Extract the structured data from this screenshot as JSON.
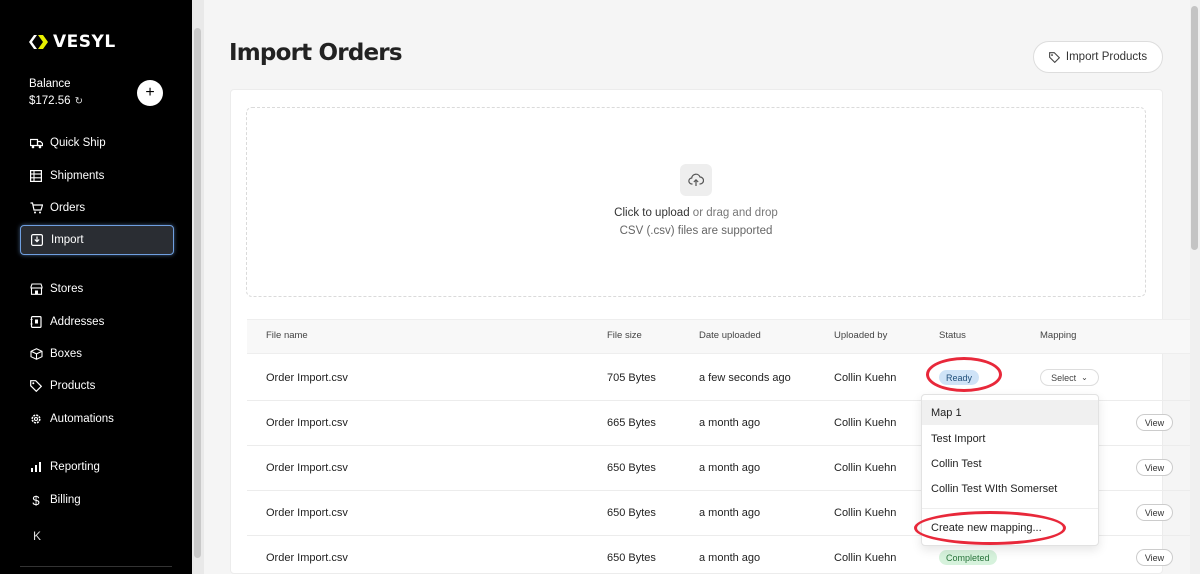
{
  "sidebar": {
    "logo_text": "VESYL",
    "balance_label": "Balance",
    "balance_value": "$172.56",
    "add_label": "+",
    "items": [
      {
        "label": "Quick Ship",
        "icon": "truck-icon"
      },
      {
        "label": "Shipments",
        "icon": "grid-icon"
      },
      {
        "label": "Orders",
        "icon": "cart-icon"
      },
      {
        "label": "Import",
        "icon": "import-icon",
        "active": true
      },
      {
        "label": "Stores",
        "icon": "store-icon"
      },
      {
        "label": "Addresses",
        "icon": "address-book-icon"
      },
      {
        "label": "Boxes",
        "icon": "box-icon"
      },
      {
        "label": "Products",
        "icon": "tag-icon"
      },
      {
        "label": "Automations",
        "icon": "gear-icon"
      },
      {
        "label": "Reporting",
        "icon": "bar-chart-icon"
      },
      {
        "label": "Billing",
        "icon": "dollar-icon"
      }
    ],
    "collapse_label": "K"
  },
  "header": {
    "title": "Import Orders",
    "import_products_label": "Import Products"
  },
  "upload": {
    "click_text": "Click to upload",
    "drag_text": "or drag and drop",
    "hint": "CSV (.csv) files are supported"
  },
  "table": {
    "columns": [
      "File name",
      "File size",
      "Date uploaded",
      "Uploaded by",
      "Status",
      "Mapping"
    ],
    "rows": [
      {
        "file": "Order Import.csv",
        "size": "705 Bytes",
        "date": "a few seconds ago",
        "by": "Collin Kuehn",
        "status": "Ready",
        "action": "Select"
      },
      {
        "file": "Order Import.csv",
        "size": "665 Bytes",
        "date": "a month ago",
        "by": "Collin Kuehn",
        "status": "",
        "action": "View"
      },
      {
        "file": "Order Import.csv",
        "size": "650 Bytes",
        "date": "a month ago",
        "by": "Collin Kuehn",
        "status": "",
        "action": "View"
      },
      {
        "file": "Order Import.csv",
        "size": "650 Bytes",
        "date": "a month ago",
        "by": "Collin Kuehn",
        "status": "",
        "action": "View"
      },
      {
        "file": "Order Import.csv",
        "size": "650 Bytes",
        "date": "a month ago",
        "by": "Collin Kuehn",
        "status": "Completed",
        "action": "View"
      }
    ]
  },
  "mapping_dropdown": {
    "options": [
      "Map 1",
      "Test Import",
      "Collin Test",
      "Collin Test WIth Somerset"
    ],
    "create_label": "Create new mapping..."
  },
  "colors": {
    "sidebar_bg": "#000000",
    "active_border": "#6f9fe0",
    "annotation_red": "#e8283a",
    "ready_bg": "#cfe3f7",
    "completed_bg": "#d6f2dc"
  }
}
